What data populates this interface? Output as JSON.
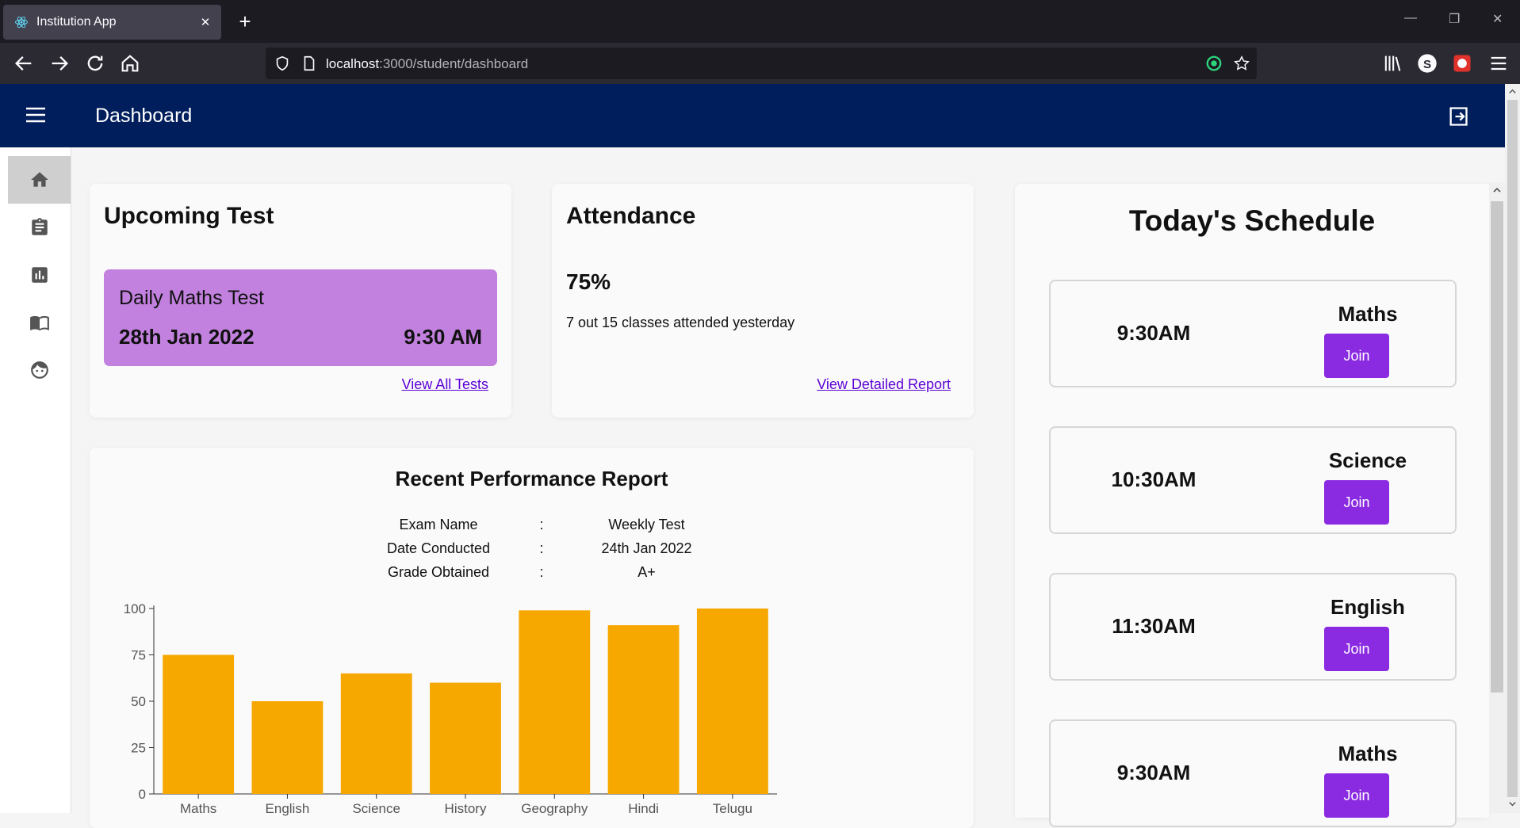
{
  "browser": {
    "tab_title": "Institution App",
    "url_host": "localhost",
    "url_rest": ":3000/student/dashboard"
  },
  "app": {
    "title": "Dashboard"
  },
  "sidebar": {
    "items": [
      {
        "icon": "home-icon",
        "active": true
      },
      {
        "icon": "clipboard-icon",
        "active": false
      },
      {
        "icon": "bar-chart-icon",
        "active": false
      },
      {
        "icon": "book-icon",
        "active": false
      },
      {
        "icon": "face-icon",
        "active": false
      }
    ]
  },
  "upcoming_test": {
    "heading": "Upcoming Test",
    "name": "Daily Maths Test",
    "date": "28th Jan 2022",
    "time": "9:30 AM",
    "link": "View All Tests"
  },
  "attendance": {
    "heading": "Attendance",
    "percent": "75%",
    "description": "7 out 15 classes attended yesterday",
    "link": "View Detailed Report"
  },
  "performance": {
    "heading": "Recent Performance Report",
    "meta": [
      {
        "label": "Exam Name",
        "sep": ":",
        "value": "Weekly Test"
      },
      {
        "label": "Date Conducted",
        "sep": ":",
        "value": "24th Jan 2022"
      },
      {
        "label": "Grade Obtained",
        "sep": ":",
        "value": "A+"
      }
    ]
  },
  "chart_data": {
    "type": "bar",
    "categories": [
      "Maths",
      "English",
      "Science",
      "History",
      "Geography",
      "Hindi",
      "Telugu"
    ],
    "values": [
      75,
      50,
      65,
      60,
      99,
      91,
      100
    ],
    "ylim": [
      0,
      100
    ],
    "yticks": [
      0,
      25,
      50,
      75,
      100
    ],
    "bar_color": "#f6a800",
    "title": "",
    "xlabel": "",
    "ylabel": ""
  },
  "schedule": {
    "heading": "Today's Schedule",
    "join_label": "Join",
    "slots": [
      {
        "time": "9:30AM",
        "subject": "Maths"
      },
      {
        "time": "10:30AM",
        "subject": "Science"
      },
      {
        "time": "11:30AM",
        "subject": "English"
      },
      {
        "time": "9:30AM",
        "subject": "Maths"
      }
    ]
  },
  "colors": {
    "appbar": "#001e5c",
    "accent_purple": "#8a2be2",
    "test_card": "#c281de",
    "link": "#5b00d6"
  }
}
